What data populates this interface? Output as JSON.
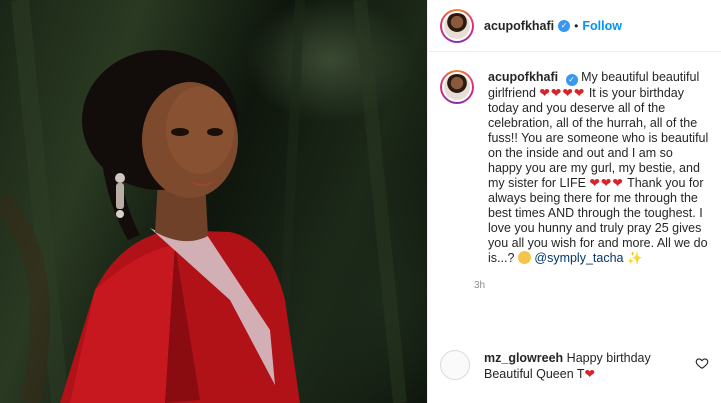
{
  "post": {
    "username": "acupofkhafi",
    "follow_label": "Follow",
    "dot": "•",
    "caption_part1": "My beautiful beautiful girlfriend",
    "hearts_a": "❤❤❤❤",
    "caption_part2": "It is your birthday today and you deserve all of the celebration, all of the hurrah, all of the fuss!! You are someone who is beautiful on the inside and out and I am so happy you are my gurl, my bestie, and my sister for LIFE",
    "hearts_b": "❤❤❤",
    "caption_part3": "Thank you for always being there for me through the best times AND through the toughest. I love you hunny and truly pray 25 gives you all you wish for and more. All we do is...?",
    "mention": "@symply_tacha",
    "sparkle": "✨",
    "time": "3h"
  },
  "comment": {
    "username": "mz_glowreeh",
    "text": "Happy birthday Beautiful Queen T",
    "heart": "❤"
  },
  "colors": {
    "accent": "#0095f6",
    "heart": "#d8232a",
    "verified": "#3897f0"
  }
}
